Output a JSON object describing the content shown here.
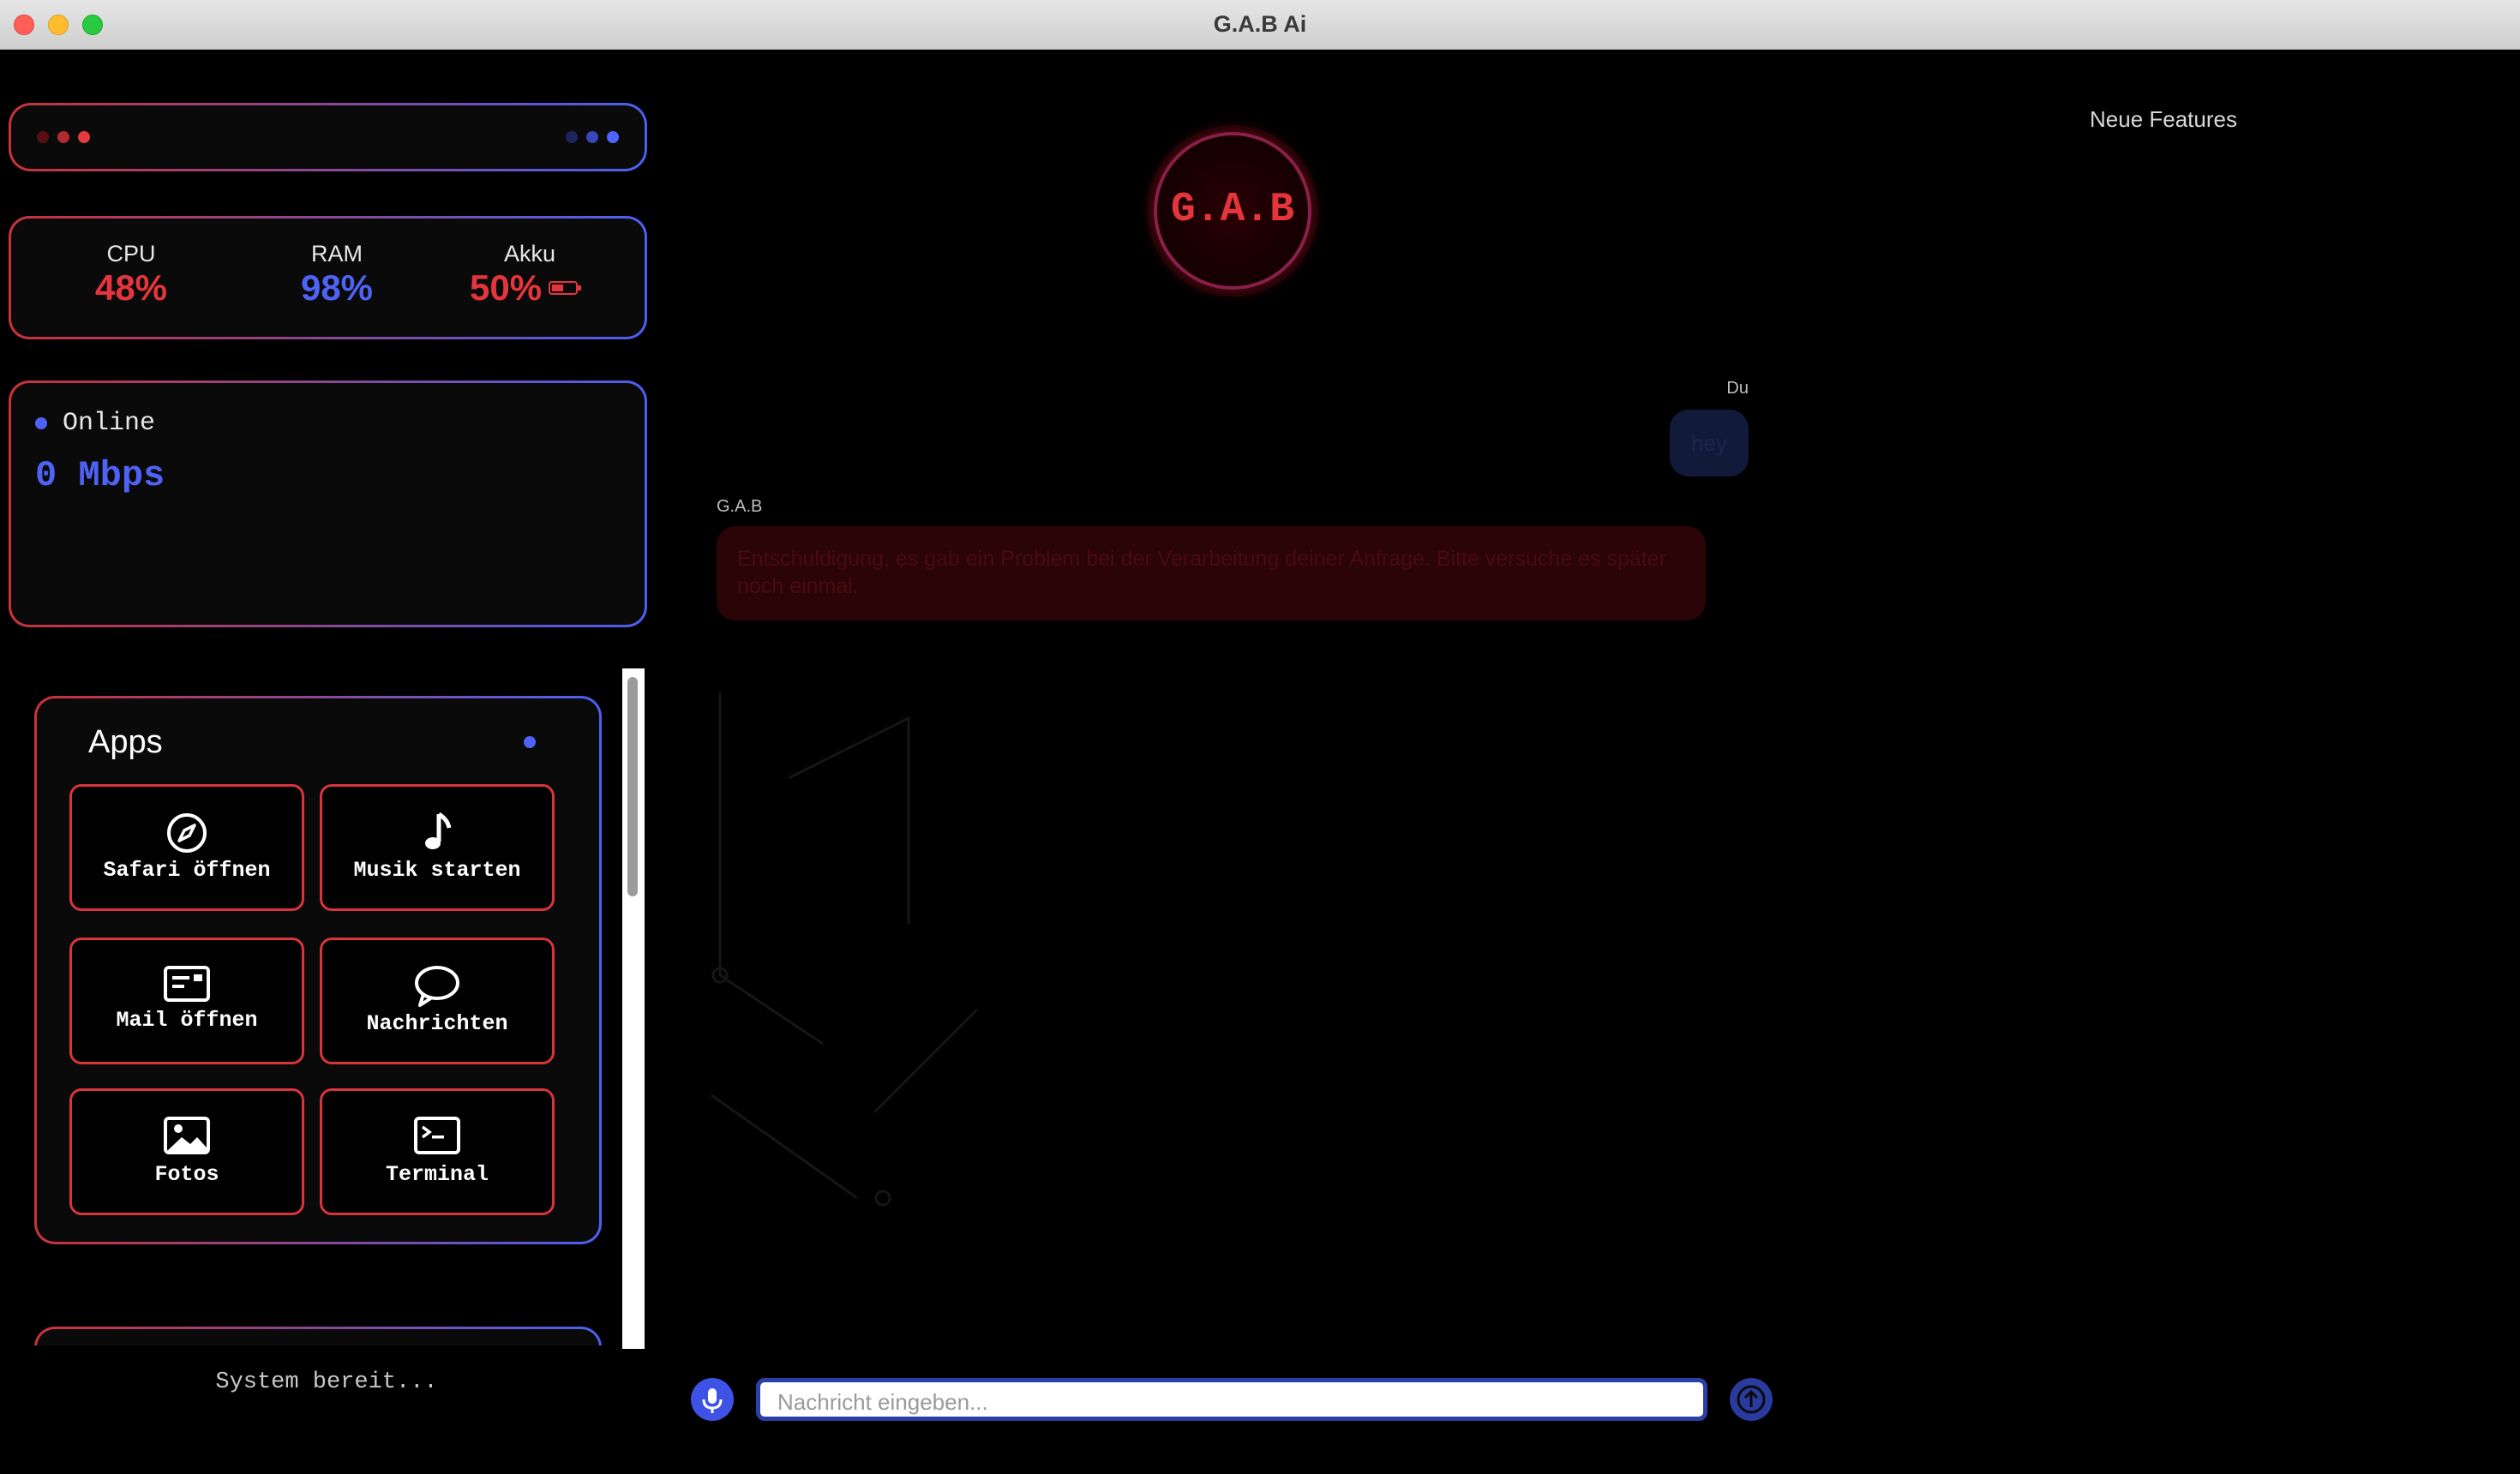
{
  "window": {
    "title": "G.A.B Ai",
    "traffic_lights": {
      "close": "#fe5f57",
      "minimize": "#febc2e",
      "zoom": "#28c840"
    }
  },
  "colors": {
    "red": "#d8353a",
    "blue": "#4a5cf0",
    "background": "#000000"
  },
  "stats": {
    "cpu": {
      "label": "CPU",
      "value": "48%"
    },
    "ram": {
      "label": "RAM",
      "value": "98%"
    },
    "akku": {
      "label": "Akku",
      "value": "50%",
      "icon": "battery-icon",
      "level": 0.5
    }
  },
  "network": {
    "status": "Online",
    "speed": "0 Mbps"
  },
  "apps": {
    "title": "Apps",
    "items": [
      {
        "label": "Safari öffnen",
        "icon": "compass-icon"
      },
      {
        "label": "Musik starten",
        "icon": "music-note-icon"
      },
      {
        "label": "Mail öffnen",
        "icon": "mail-icon"
      },
      {
        "label": "Nachrichten",
        "icon": "chat-bubble-icon"
      },
      {
        "label": "Fotos",
        "icon": "photo-icon"
      },
      {
        "label": "Terminal",
        "icon": "terminal-icon"
      }
    ]
  },
  "status_text": "System bereit...",
  "header": {
    "logo_text": "G.A.B",
    "features_link": "Neue Features"
  },
  "chat": {
    "messages": [
      {
        "sender": "Du",
        "text": "hey"
      },
      {
        "sender": "G.A.B",
        "text": "Entschuldigung, es gab ein Problem bei der Verarbeitung deiner Anfrage. Bitte versuche es später noch einmal."
      }
    ]
  },
  "composer": {
    "placeholder": "Nachricht eingeben...",
    "mic_icon": "microphone-icon",
    "send_icon": "arrow-up-icon"
  }
}
